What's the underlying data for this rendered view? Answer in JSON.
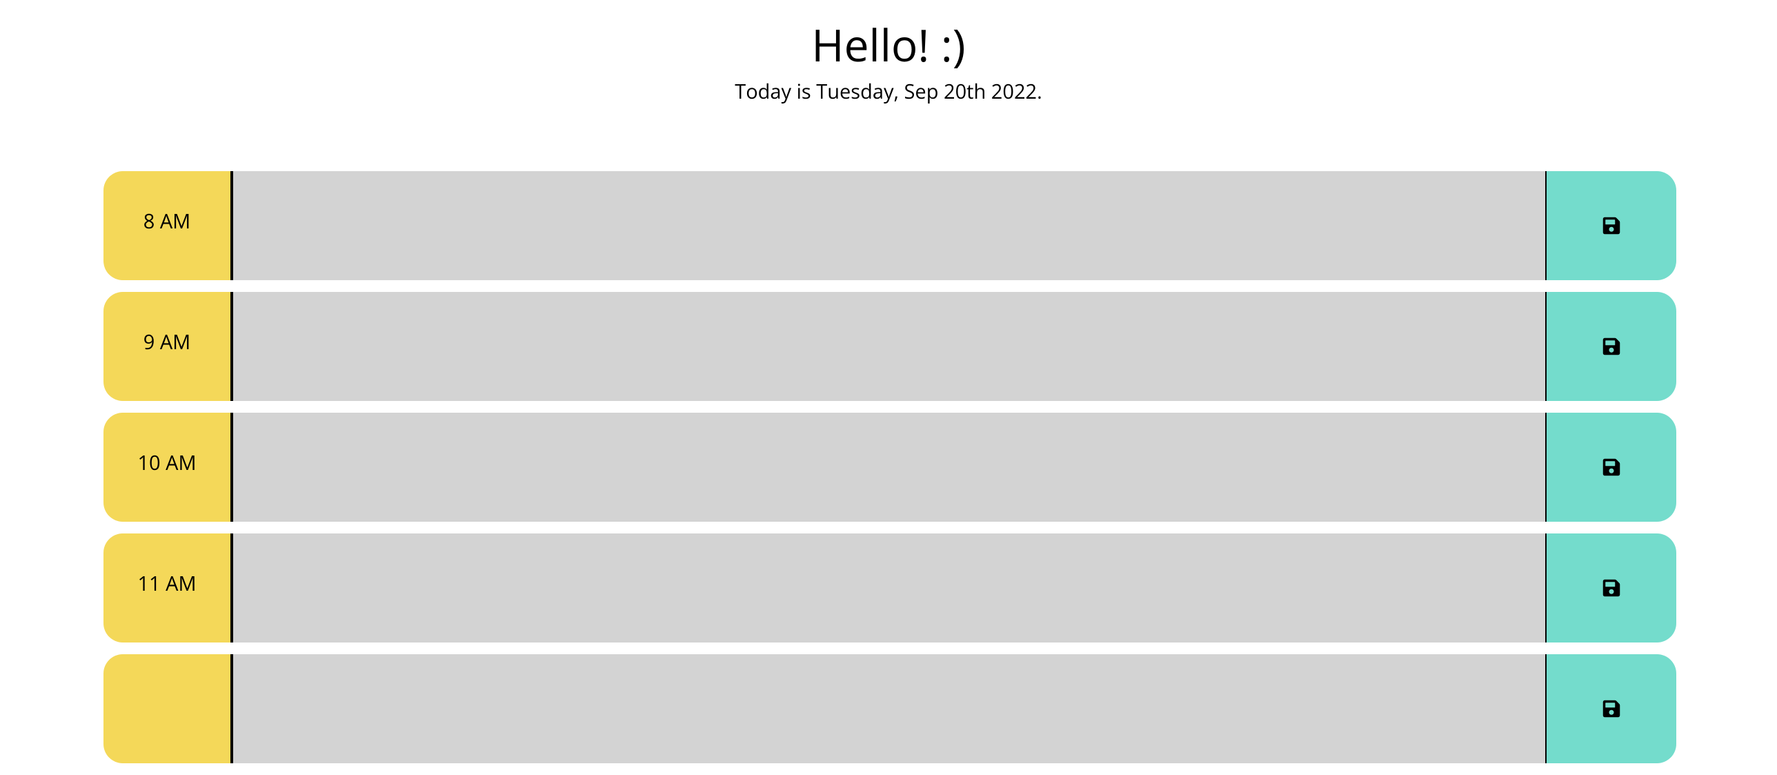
{
  "header": {
    "title": "Hello! :)",
    "date_line": "Today is Tuesday, Sep 20th 2022."
  },
  "colors": {
    "hour_bg": "#f4d859",
    "description_bg": "#d3d3d3",
    "save_bg": "#74dccc"
  },
  "rows": [
    {
      "hour": "8 AM",
      "description": "",
      "save_icon": "floppy-disk-icon"
    },
    {
      "hour": "9 AM",
      "description": "",
      "save_icon": "floppy-disk-icon"
    },
    {
      "hour": "10 AM",
      "description": "",
      "save_icon": "floppy-disk-icon"
    },
    {
      "hour": "11 AM",
      "description": "",
      "save_icon": "floppy-disk-icon"
    },
    {
      "hour": "",
      "description": "",
      "save_icon": "floppy-disk-icon"
    }
  ]
}
